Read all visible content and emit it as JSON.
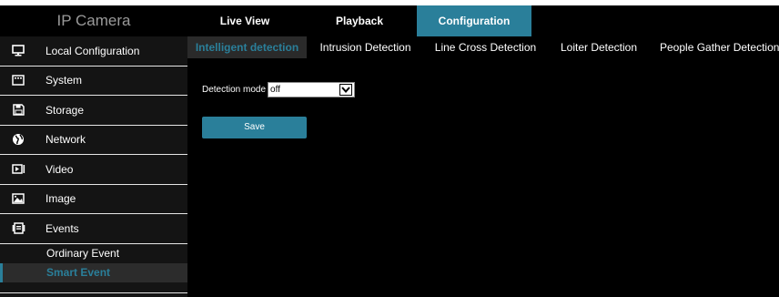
{
  "brand": {
    "title": "IP Camera"
  },
  "topnav": {
    "items": [
      {
        "label": "Live View"
      },
      {
        "label": "Playback"
      },
      {
        "label": "Configuration"
      }
    ],
    "active_index": 2
  },
  "sidebar": {
    "items": [
      {
        "label": "Local Configuration",
        "icon": "monitor-icon"
      },
      {
        "label": "System",
        "icon": "system-icon"
      },
      {
        "label": "Storage",
        "icon": "storage-icon"
      },
      {
        "label": "Network",
        "icon": "network-icon"
      },
      {
        "label": "Video",
        "icon": "video-icon"
      },
      {
        "label": "Image",
        "icon": "image-icon"
      },
      {
        "label": "Events",
        "icon": "events-icon"
      }
    ],
    "sub_items": [
      {
        "label": "Ordinary Event"
      },
      {
        "label": "Smart Event"
      }
    ],
    "active_sub_index": 1
  },
  "tabs": {
    "items": [
      {
        "label": "Intelligent detection"
      },
      {
        "label": "Intrusion Detection"
      },
      {
        "label": "Line Cross Detection"
      },
      {
        "label": "Loiter Detection"
      },
      {
        "label": "People Gather Detection"
      }
    ],
    "active_index": 0
  },
  "form": {
    "detection_mode_label": "Detection mode",
    "detection_mode_value": "off",
    "save_label": "Save"
  },
  "colors": {
    "accent": "#2a7f9a",
    "background": "#000000",
    "sidebar": "#141414"
  }
}
